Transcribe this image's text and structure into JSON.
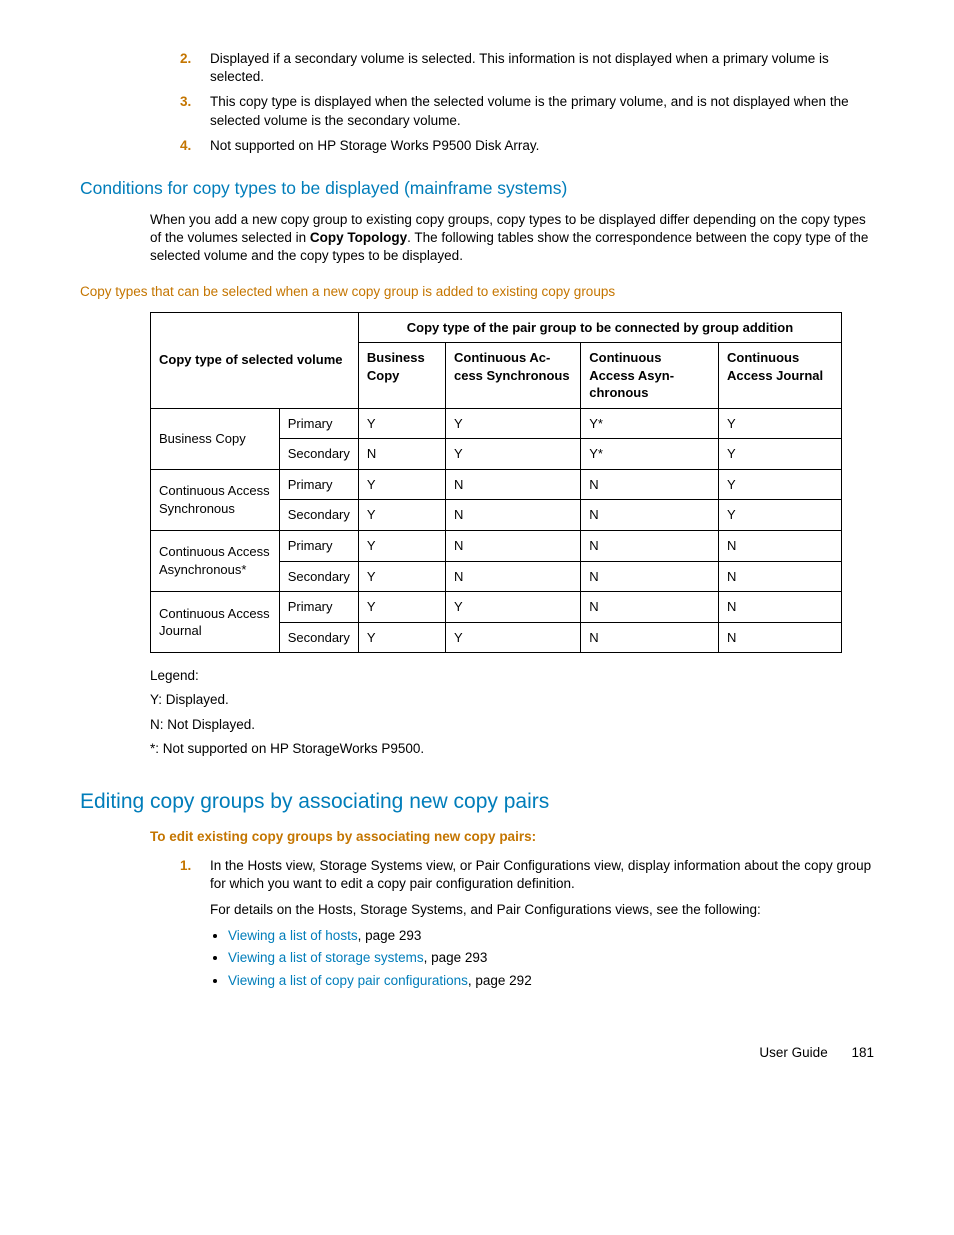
{
  "ordered_start": {
    "items": [
      {
        "num": "2.",
        "text": "Displayed if a secondary volume is selected. This information is not displayed when a primary volume is selected."
      },
      {
        "num": "3.",
        "text": "This copy type is displayed when the selected volume is the primary volume, and is not displayed when the selected volume is the secondary volume."
      },
      {
        "num": "4.",
        "text": "Not supported on HP Storage Works P9500 Disk Array."
      }
    ]
  },
  "sec1": {
    "heading": "Conditions for copy types to be displayed (mainframe systems)",
    "para_a": "When you add a new copy group to existing copy groups, copy types to be displayed differ depending on the copy types of the volumes selected in ",
    "para_bold": "Copy Topology",
    "para_b": ". The following tables show the correspondence between the copy type of the selected volume and the copy types to be displayed."
  },
  "table1": {
    "caption": "Copy types that can be selected when a new copy group is added to existing copy groups",
    "row_header_span": "Copy type of selected volume",
    "col_header_span": "Copy type of the pair group to be connected by group addition",
    "cols": [
      "Business Copy",
      "Continuous Ac­cess Synchron­ous",
      "Continuous Access Asyn­chronous",
      "Continuous Access Journ­al"
    ],
    "rows": [
      {
        "label": "Business Copy",
        "sub": [
          {
            "k": "Primary",
            "v": [
              "Y",
              "Y",
              "Y*",
              "Y"
            ]
          },
          {
            "k": "Secondary",
            "v": [
              "N",
              "Y",
              "Y*",
              "Y"
            ]
          }
        ]
      },
      {
        "label": "Continuous Ac­cess Synchron­ous",
        "sub": [
          {
            "k": "Primary",
            "v": [
              "Y",
              "N",
              "N",
              "Y"
            ]
          },
          {
            "k": "Secondary",
            "v": [
              "Y",
              "N",
              "N",
              "Y"
            ]
          }
        ]
      },
      {
        "label": "Continuous Ac­cess Asynchron­ous*",
        "sub": [
          {
            "k": "Primary",
            "v": [
              "Y",
              "N",
              "N",
              "N"
            ]
          },
          {
            "k": "Secondary",
            "v": [
              "Y",
              "N",
              "N",
              "N"
            ]
          }
        ]
      },
      {
        "label": "Continuous Ac­cess Journal",
        "sub": [
          {
            "k": "Primary",
            "v": [
              "Y",
              "Y",
              "N",
              "N"
            ]
          },
          {
            "k": "Secondary",
            "v": [
              "Y",
              "Y",
              "N",
              "N"
            ]
          }
        ]
      }
    ]
  },
  "legend": {
    "l0": "Legend:",
    "l1": "Y: Displayed.",
    "l2": "N: Not Displayed.",
    "l3": "*: Not supported on HP StorageWorks P9500."
  },
  "sec2": {
    "heading": "Editing copy groups by associating new copy pairs",
    "proc": "To edit existing copy groups by associating new copy pairs:",
    "step1_num": "1.",
    "step1_text": "In the Hosts view, Storage Systems view, or Pair Configurations view, display information about the copy group for which you want to edit a copy pair configuration definition.",
    "step1_sub": "For details on the Hosts, Storage Systems, and Pair Configurations views, see the following:",
    "bullets": [
      {
        "link": "Viewing a list of hosts",
        "rest": ", page 293"
      },
      {
        "link": "Viewing a list of storage systems",
        "rest": ", page 293"
      },
      {
        "link": "Viewing a list of copy pair configurations",
        "rest": ", page 292"
      }
    ]
  },
  "footer": {
    "label": "User Guide",
    "page": "181"
  }
}
